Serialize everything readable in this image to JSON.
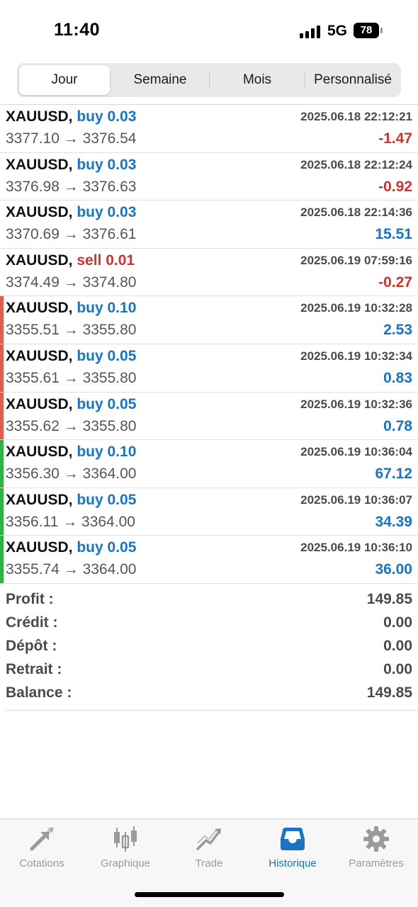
{
  "status": {
    "time": "11:40",
    "network": "5G",
    "battery": "78"
  },
  "periods": [
    "Jour",
    "Semaine",
    "Mois",
    "Personnalisé"
  ],
  "active_period": "Jour",
  "trades": [
    {
      "symbol": "XAUUSD,",
      "side": "buy",
      "volume": "0.03",
      "datetime": "2025.06.18 22:12:21",
      "prices": "3377.10 → 3376.54",
      "profit": "-1.47",
      "marker": ""
    },
    {
      "symbol": "XAUUSD,",
      "side": "buy",
      "volume": "0.03",
      "datetime": "2025.06.18 22:12:24",
      "prices": "3376.98 → 3376.63",
      "profit": "-0.92",
      "marker": ""
    },
    {
      "symbol": "XAUUSD,",
      "side": "buy",
      "volume": "0.03",
      "datetime": "2025.06.18 22:14:36",
      "prices": "3370.69 → 3376.61",
      "profit": "15.51",
      "marker": ""
    },
    {
      "symbol": "XAUUSD,",
      "side": "sell",
      "volume": "0.01",
      "datetime": "2025.06.19 07:59:16",
      "prices": "3374.49 → 3374.80",
      "profit": "-0.27",
      "marker": ""
    },
    {
      "symbol": "XAUUSD,",
      "side": "buy",
      "volume": "0.10",
      "datetime": "2025.06.19 10:32:28",
      "prices": "3355.51 → 3355.80",
      "profit": "2.53",
      "marker": "#e35d4e"
    },
    {
      "symbol": "XAUUSD,",
      "side": "buy",
      "volume": "0.05",
      "datetime": "2025.06.19 10:32:34",
      "prices": "3355.61 → 3355.80",
      "profit": "0.83",
      "marker": "#e35d4e"
    },
    {
      "symbol": "XAUUSD,",
      "side": "buy",
      "volume": "0.05",
      "datetime": "2025.06.19 10:32:36",
      "prices": "3355.62 → 3355.80",
      "profit": "0.78",
      "marker": "#e35d4e"
    },
    {
      "symbol": "XAUUSD,",
      "side": "buy",
      "volume": "0.10",
      "datetime": "2025.06.19 10:36:04",
      "prices": "3356.30 → 3364.00",
      "profit": "67.12",
      "marker": "#2db342"
    },
    {
      "symbol": "XAUUSD,",
      "side": "buy",
      "volume": "0.05",
      "datetime": "2025.06.19 10:36:07",
      "prices": "3356.11 → 3364.00",
      "profit": "34.39",
      "marker": "#2db342"
    },
    {
      "symbol": "XAUUSD,",
      "side": "buy",
      "volume": "0.05",
      "datetime": "2025.06.19 10:36:10",
      "prices": "3355.74 → 3364.00",
      "profit": "36.00",
      "marker": "#2db342"
    }
  ],
  "summary": [
    {
      "label": "Profit :",
      "value": "149.85"
    },
    {
      "label": "Crédit :",
      "value": "0.00"
    },
    {
      "label": "Dépôt :",
      "value": "0.00"
    },
    {
      "label": "Retrait :",
      "value": "0.00"
    },
    {
      "label": "Balance :",
      "value": "149.85"
    }
  ],
  "tabs": [
    {
      "label": "Cotations",
      "icon": "cotations-arrows-icon"
    },
    {
      "label": "Graphique",
      "icon": "candlestick-chart-icon"
    },
    {
      "label": "Trade",
      "icon": "trade-trend-icon"
    },
    {
      "label": "Historique",
      "icon": "history-inbox-icon"
    },
    {
      "label": "Paramètres",
      "icon": "gear-icon"
    }
  ],
  "active_tab": "Historique",
  "colors": {
    "buy": "#1a73c5",
    "sell": "#d0342c",
    "profit_positive": "#1a73c5",
    "profit_negative": "#d0342c",
    "active_tab": "#1a73c5",
    "inactive_tab": "#9a9a9a"
  }
}
